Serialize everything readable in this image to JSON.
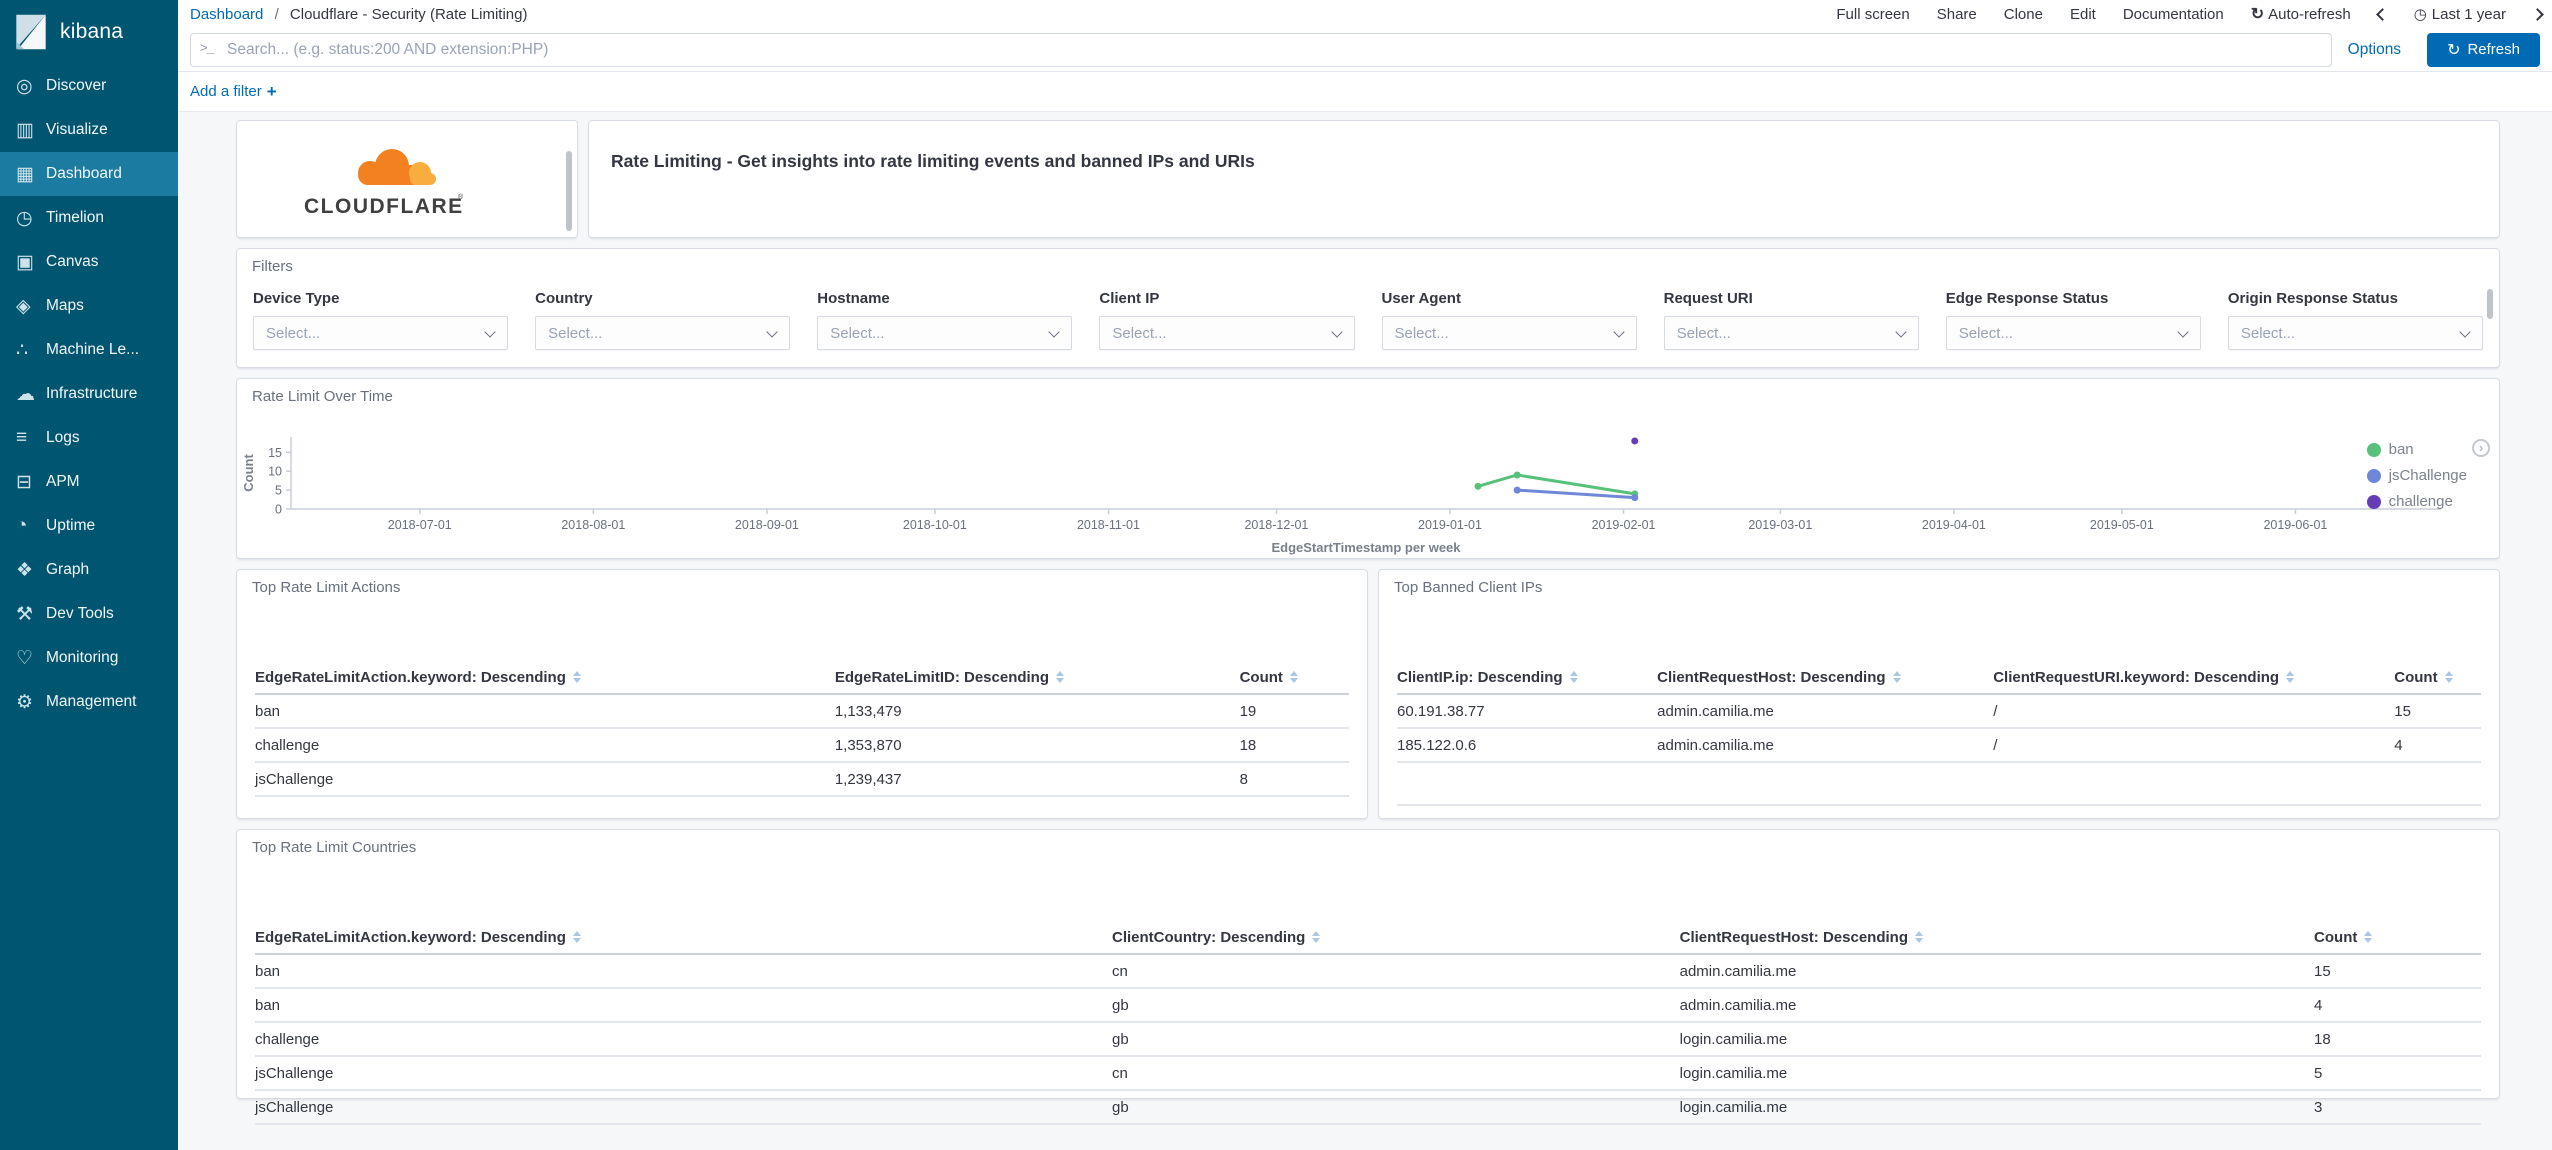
{
  "app": {
    "logo_text": "kibana"
  },
  "colors": {
    "sidebar_bg": "#005571",
    "sidebar_active_bg": "#1b7ba0",
    "accent_blue": "#006bb4",
    "cloudflare_orange": "#f48120",
    "cloudflare_orange_light": "#faad3f"
  },
  "sidebar": {
    "items": [
      {
        "label": "Discover",
        "icon": "compass",
        "glyph": "◎",
        "active": false
      },
      {
        "label": "Visualize",
        "icon": "bar-chart",
        "glyph": "▥",
        "active": false
      },
      {
        "label": "Dashboard",
        "icon": "dashboard-grid",
        "glyph": "▦",
        "active": true
      },
      {
        "label": "Timelion",
        "icon": "timelion",
        "glyph": "◷",
        "active": false
      },
      {
        "label": "Canvas",
        "icon": "canvas-frame",
        "glyph": "▣",
        "active": false
      },
      {
        "label": "Maps",
        "icon": "map-pin",
        "glyph": "◈",
        "active": false
      },
      {
        "label": "Machine Le...",
        "icon": "machine-learning",
        "glyph": "∴",
        "active": false
      },
      {
        "label": "Infrastructure",
        "icon": "cloud-server",
        "glyph": "☁",
        "active": false
      },
      {
        "label": "Logs",
        "icon": "log-lines",
        "glyph": "≡",
        "active": false
      },
      {
        "label": "APM",
        "icon": "apm-nodes",
        "glyph": "⊟",
        "active": false
      },
      {
        "label": "Uptime",
        "icon": "uptime-clock",
        "glyph": "◔",
        "active": false
      },
      {
        "label": "Graph",
        "icon": "graph-network",
        "glyph": "❖",
        "active": false
      },
      {
        "label": "Dev Tools",
        "icon": "dev-tools-wrench",
        "glyph": "⚒",
        "active": false
      },
      {
        "label": "Monitoring",
        "icon": "monitoring-heart",
        "glyph": "♡",
        "active": false
      },
      {
        "label": "Management",
        "icon": "management-gear",
        "glyph": "⚙",
        "active": false
      }
    ]
  },
  "topbar": {
    "breadcrumb": {
      "link": "Dashboard",
      "separator": "/",
      "current": "Cloudflare - Security (Rate Limiting)"
    },
    "menu_items": [
      "Full screen",
      "Share",
      "Clone",
      "Edit",
      "Documentation"
    ],
    "auto_refresh_label": "Auto-refresh",
    "time_range_label": "Last 1 year",
    "search": {
      "value": "",
      "placeholder": "Search... (e.g. status:200 AND extension:PHP)"
    },
    "options_label": "Options",
    "refresh_label": "Refresh",
    "add_filter_label": "Add a filter",
    "plus": "+"
  },
  "panels": {
    "logo": {
      "brand": "CLOUDFLARE",
      "registered": "®"
    },
    "title": {
      "text": "Rate Limiting - Get insights into rate limiting events and banned IPs and URIs"
    },
    "filters": {
      "title": "Filters",
      "select_placeholder": "Select...",
      "fields": [
        "Device Type",
        "Country",
        "Hostname",
        "Client IP",
        "User Agent",
        "Request URI",
        "Edge Response Status",
        "Origin Response Status"
      ]
    },
    "chart": {
      "title": "Rate Limit Over Time"
    },
    "table_actions": {
      "title": "Top Rate Limit Actions",
      "columns": [
        "EdgeRateLimitAction.keyword: Descending",
        "EdgeRateLimitID: Descending",
        "Count"
      ],
      "rows": [
        [
          "ban",
          "1,133,479",
          "19"
        ],
        [
          "challenge",
          "1,353,870",
          "18"
        ],
        [
          "jsChallenge",
          "1,239,437",
          "8"
        ]
      ],
      "empty_rows": 1
    },
    "table_banned": {
      "title": "Top Banned Client IPs",
      "columns": [
        "ClientIP.ip: Descending",
        "ClientRequestHost: Descending",
        "ClientRequestURI.keyword: Descending",
        "Count"
      ],
      "rows": [
        [
          "60.191.38.77",
          "admin.camilia.me",
          "/",
          "15"
        ],
        [
          "185.122.0.6",
          "admin.camilia.me",
          "/",
          "4"
        ]
      ],
      "empty_rows": 2
    },
    "table_countries": {
      "title": "Top Rate Limit Countries",
      "columns": [
        "EdgeRateLimitAction.keyword: Descending",
        "ClientCountry: Descending",
        "ClientRequestHost: Descending",
        "Count"
      ],
      "rows": [
        [
          "ban",
          "cn",
          "admin.camilia.me",
          "15"
        ],
        [
          "ban",
          "gb",
          "admin.camilia.me",
          "4"
        ],
        [
          "challenge",
          "gb",
          "login.camilia.me",
          "18"
        ],
        [
          "jsChallenge",
          "cn",
          "login.camilia.me",
          "5"
        ],
        [
          "jsChallenge",
          "gb",
          "login.camilia.me",
          "3"
        ]
      ],
      "empty_rows": 0
    }
  },
  "chart_data": {
    "type": "line",
    "title": "Rate Limit Over Time",
    "xlabel": "EdgeStartTimestamp per week",
    "ylabel": "Count",
    "ylim": [
      0,
      19
    ],
    "yticks": [
      0,
      5,
      10,
      15
    ],
    "x_range": [
      "2018-06-08",
      "2019-06-27"
    ],
    "xticks": [
      "2018-07-01",
      "2018-08-01",
      "2018-09-01",
      "2018-10-01",
      "2018-11-01",
      "2018-12-01",
      "2019-01-01",
      "2019-02-01",
      "2019-03-01",
      "2019-04-01",
      "2019-05-01",
      "2019-06-01"
    ],
    "grid": false,
    "legend_position": "right",
    "series": [
      {
        "name": "ban",
        "color": "#57c17b",
        "points": [
          [
            "2019-01-06",
            6
          ],
          [
            "2019-01-13",
            9
          ],
          [
            "2019-02-03",
            4
          ]
        ]
      },
      {
        "name": "jsChallenge",
        "color": "#6f87d8",
        "points": [
          [
            "2019-01-13",
            5
          ],
          [
            "2019-02-03",
            3
          ]
        ]
      },
      {
        "name": "challenge",
        "color": "#663db8",
        "points": [
          [
            "2019-02-03",
            18
          ]
        ]
      }
    ]
  }
}
